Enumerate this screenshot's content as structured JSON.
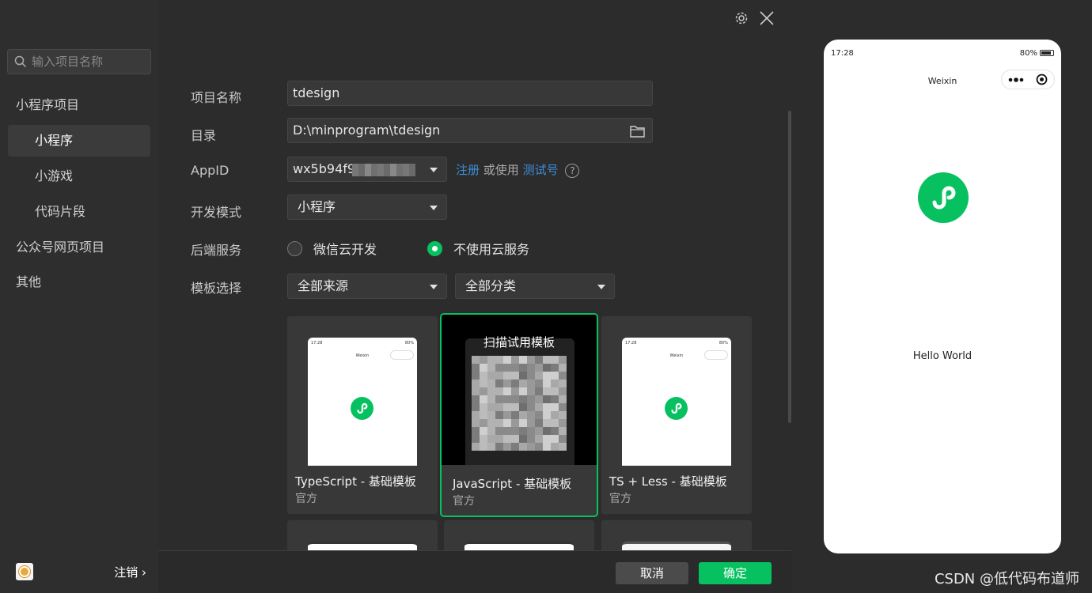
{
  "sidebar": {
    "search_placeholder": "输入项目名称",
    "items": [
      {
        "label": "小程序项目"
      },
      {
        "label": "小程序"
      },
      {
        "label": "小游戏"
      },
      {
        "label": "代码片段"
      },
      {
        "label": "公众号网页项目"
      },
      {
        "label": "其他"
      }
    ],
    "logout_label": "注销",
    "logout_chevron": "›"
  },
  "form": {
    "project_name_label": "项目名称",
    "project_name_value": "tdesign",
    "directory_label": "目录",
    "directory_value": "D:\\minprogram\\tdesign",
    "appid_label": "AppID",
    "appid_value": "wx5b94f9",
    "register_link": "注册",
    "or_use_text": "或使用",
    "test_account_link": "测试号",
    "help_glyph": "?",
    "dev_mode_label": "开发模式",
    "dev_mode_value": "小程序",
    "backend_label": "后端服务",
    "backend_options": [
      {
        "label": "微信云开发",
        "selected": false
      },
      {
        "label": "不使用云服务",
        "selected": true
      }
    ],
    "template_label": "模板选择",
    "source_select": "全部来源",
    "category_select": "全部分类"
  },
  "templates": [
    {
      "title": "TypeScript - 基础模板",
      "subtitle": "官方"
    },
    {
      "title": "JavaScript - 基础模板",
      "subtitle": "官方",
      "overlay": "扫描试用模板"
    },
    {
      "title": "TS + Less - 基础模板",
      "subtitle": "官方"
    }
  ],
  "thumb_phone": {
    "time": "17:28",
    "battery": "80%",
    "title": "Weixin"
  },
  "buttons": {
    "cancel": "取消",
    "confirm": "确定"
  },
  "preview": {
    "time": "17:28",
    "battery": "80%",
    "title": "Weixin",
    "hello": "Hello World"
  },
  "watermark": "CSDN @低代码布道师",
  "colors": {
    "accent": "#07c160",
    "link": "#3d8fdd",
    "background": "#2c2c2c"
  }
}
